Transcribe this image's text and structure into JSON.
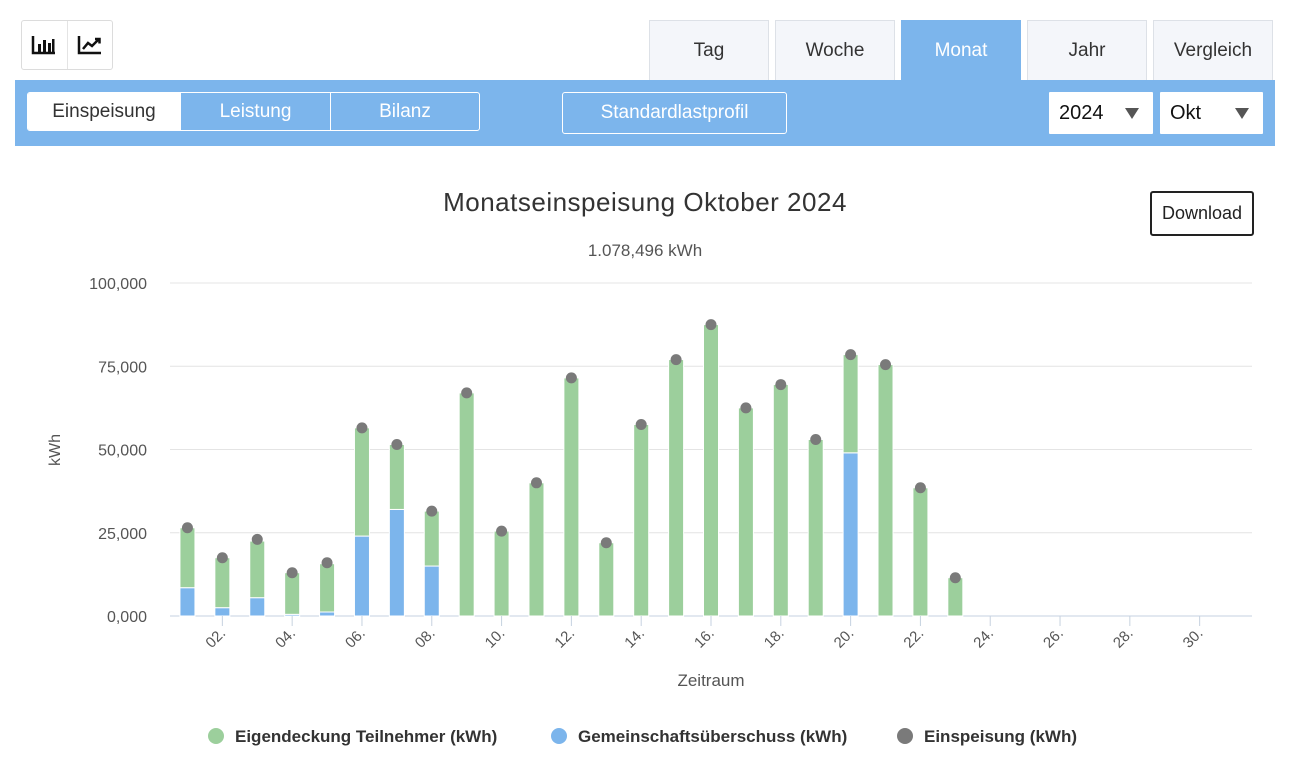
{
  "view_toggle": {
    "items": [
      {
        "name": "bar-chart-icon"
      },
      {
        "name": "line-chart-icon"
      }
    ]
  },
  "period_tabs": [
    {
      "label": "Tag",
      "active": false
    },
    {
      "label": "Woche",
      "active": false
    },
    {
      "label": "Monat",
      "active": true
    },
    {
      "label": "Jahr",
      "active": false
    },
    {
      "label": "Vergleich",
      "active": false
    }
  ],
  "toolbar": {
    "segments": [
      {
        "label": "Einspeisung",
        "active": true
      },
      {
        "label": "Leistung",
        "active": false
      },
      {
        "label": "Bilanz",
        "active": false
      }
    ],
    "standardlastprofil_label": "Standardlastprofil",
    "year_select": {
      "value": "2024"
    },
    "month_select": {
      "value": "Okt"
    }
  },
  "download_label": "Download",
  "colors": {
    "accent": "#7cb5ec",
    "green": "#9ccf9c",
    "blue": "#7cb5ec",
    "dot": "#7a7a7a"
  },
  "chart_data": {
    "type": "bar",
    "title": "Monatseinspeisung Oktober 2024",
    "subtitle": "1.078,496 kWh",
    "xlabel": "Zeitraum",
    "ylabel": "kWh",
    "ylim": [
      0,
      100
    ],
    "yticks": [
      "0,000",
      "25,000",
      "50,000",
      "75,000",
      "100,000"
    ],
    "xticks": [
      "02.",
      "04.",
      "06.",
      "08.",
      "10.",
      "12.",
      "14.",
      "16.",
      "18.",
      "20.",
      "22.",
      "24.",
      "26.",
      "28.",
      "30."
    ],
    "days": 31,
    "stacked": true,
    "series": [
      {
        "name": "Eigendeckung Teilnehmer (kWh)",
        "type": "bar",
        "color": "#9ccf9c",
        "values": [
          18,
          15,
          17,
          12.5,
          14.5,
          32.5,
          19.5,
          16.5,
          67,
          25.5,
          40,
          71.5,
          22,
          57.5,
          77,
          87.5,
          62.5,
          69.5,
          53,
          29.5,
          75.5,
          38.5,
          11.5,
          0,
          0,
          0,
          0,
          0,
          0,
          0,
          0
        ]
      },
      {
        "name": "Gemeinschaftsüberschuss (kWh)",
        "type": "bar",
        "color": "#7cb5ec",
        "values": [
          8.5,
          2.5,
          5.5,
          0.5,
          1.2,
          24,
          32,
          15,
          0,
          0,
          0,
          0,
          0,
          0,
          0,
          0,
          0,
          0,
          0,
          49,
          0,
          0,
          0,
          0,
          0,
          0,
          0,
          0,
          0,
          0,
          0
        ]
      },
      {
        "name": "Einspeisung (kWh)",
        "type": "scatter",
        "color": "#7a7a7a",
        "values": [
          26.5,
          17.5,
          23,
          13,
          16,
          56.5,
          51.5,
          31.5,
          67,
          25.5,
          40,
          71.5,
          22,
          57.5,
          77,
          87.5,
          62.5,
          69.5,
          53,
          78.5,
          75.5,
          38.5,
          11.5,
          0,
          0,
          0,
          0,
          0,
          0,
          0,
          0
        ]
      }
    ],
    "legend_position": "bottom-center"
  }
}
